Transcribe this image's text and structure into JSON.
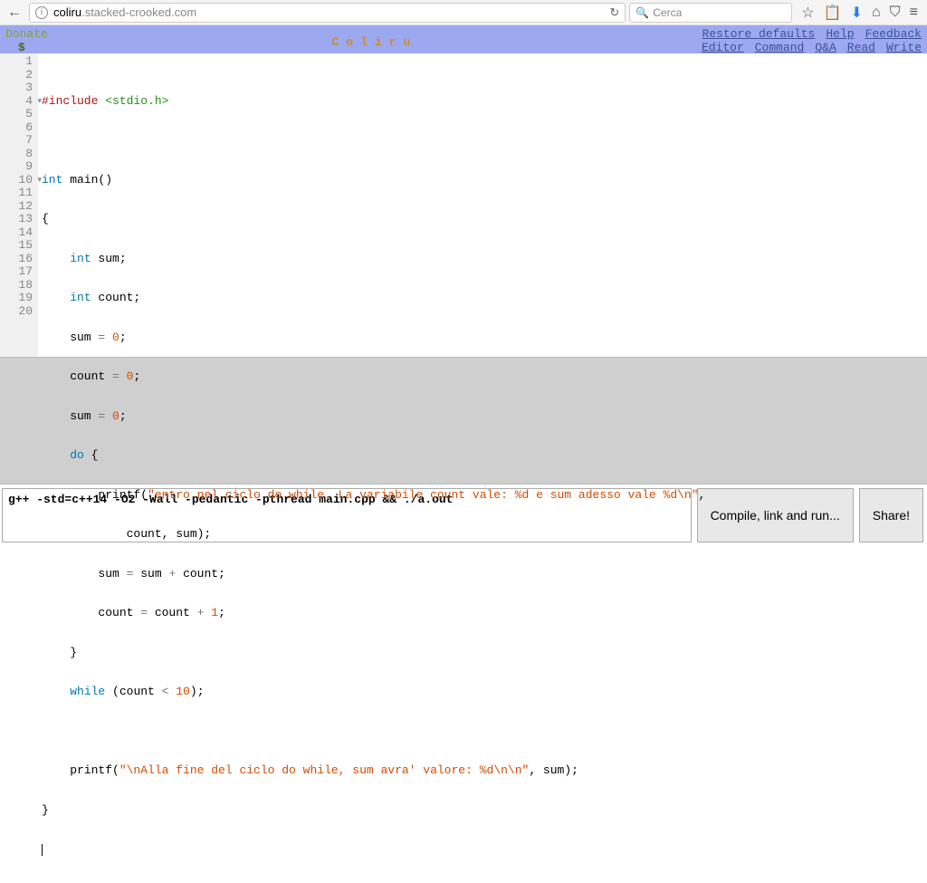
{
  "browser": {
    "url_domain": "coliru",
    "url_rest": ".stacked-crooked.com",
    "search_placeholder": "Cerca"
  },
  "header": {
    "donate": "Donate",
    "dollar": "$",
    "title": "Coliru",
    "links": {
      "restore": "Restore defaults",
      "help": "Help",
      "feedback": "Feedback",
      "editor": "Editor",
      "command": "Command",
      "qa": "Q&A",
      "read": "Read",
      "write": "Write"
    }
  },
  "gutter": [
    "1",
    "2",
    "3",
    "4",
    "5",
    "6",
    "7",
    "8",
    "9",
    "10",
    "11",
    "12",
    "13",
    "14",
    "15",
    "16",
    "17",
    "18",
    "19",
    "20"
  ],
  "code": {
    "l1_a": "#include ",
    "l1_b": "<stdio.h>",
    "l3_a": "int",
    "l3_b": " main()",
    "l4": "{",
    "l5_a": "    ",
    "l5_b": "int",
    "l5_c": " sum;",
    "l6_a": "    ",
    "l6_b": "int",
    "l6_c": " count;",
    "l7_a": "    sum ",
    "l7_b": "=",
    "l7_c": " ",
    "l7_d": "0",
    "l7_e": ";",
    "l8_a": "    count ",
    "l8_b": "=",
    "l8_c": " ",
    "l8_d": "0",
    "l8_e": ";",
    "l9_a": "    sum ",
    "l9_b": "=",
    "l9_c": " ",
    "l9_d": "0",
    "l9_e": ";",
    "l10_a": "    ",
    "l10_b": "do",
    "l10_c": " {",
    "l11_a": "        printf(",
    "l11_b": "\"entro nel ciclo do while. La variabile count vale: %d e sum adesso vale %d\\n\"",
    "l11_c": ",",
    "l12": "            count, sum);",
    "l13_a": "        sum ",
    "l13_b": "=",
    "l13_c": " sum ",
    "l13_d": "+",
    "l13_e": " count;",
    "l14_a": "        count ",
    "l14_b": "=",
    "l14_c": " count ",
    "l14_d": "+",
    "l14_e": " ",
    "l14_f": "1",
    "l14_g": ";",
    "l15": "    }",
    "l16_a": "    ",
    "l16_b": "while",
    "l16_c": " (count ",
    "l16_d": "<",
    "l16_e": " ",
    "l16_f": "10",
    "l16_g": ");",
    "l18_a": "    printf(",
    "l18_b": "\"\\nAlla fine del ciclo do while, sum avra' valore: %d\\n\\n\"",
    "l18_c": ", sum);",
    "l19": "}"
  },
  "command": "g++ -std=c++14 -O2 -Wall -pedantic -pthread main.cpp && ./a.out",
  "buttons": {
    "compile": "Compile, link and run...",
    "share": "Share!"
  }
}
